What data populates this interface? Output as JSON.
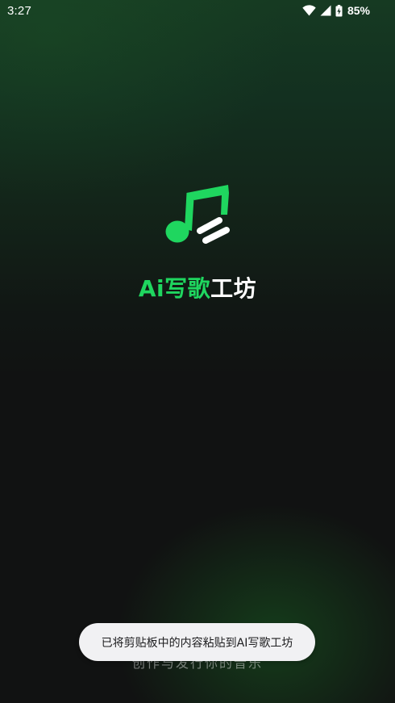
{
  "status_bar": {
    "time": "3:27",
    "battery": "85%",
    "icons": [
      "wifi-icon",
      "cell-signal-icon",
      "battery-charging-icon"
    ]
  },
  "app": {
    "name_accent": "Ai写歌",
    "name_plain": "工坊",
    "tagline": "创作与发行你的音乐",
    "accent_color": "#1fd65f"
  },
  "toast": {
    "message": "已将剪贴板中的内容粘贴到AI写歌工坊"
  }
}
